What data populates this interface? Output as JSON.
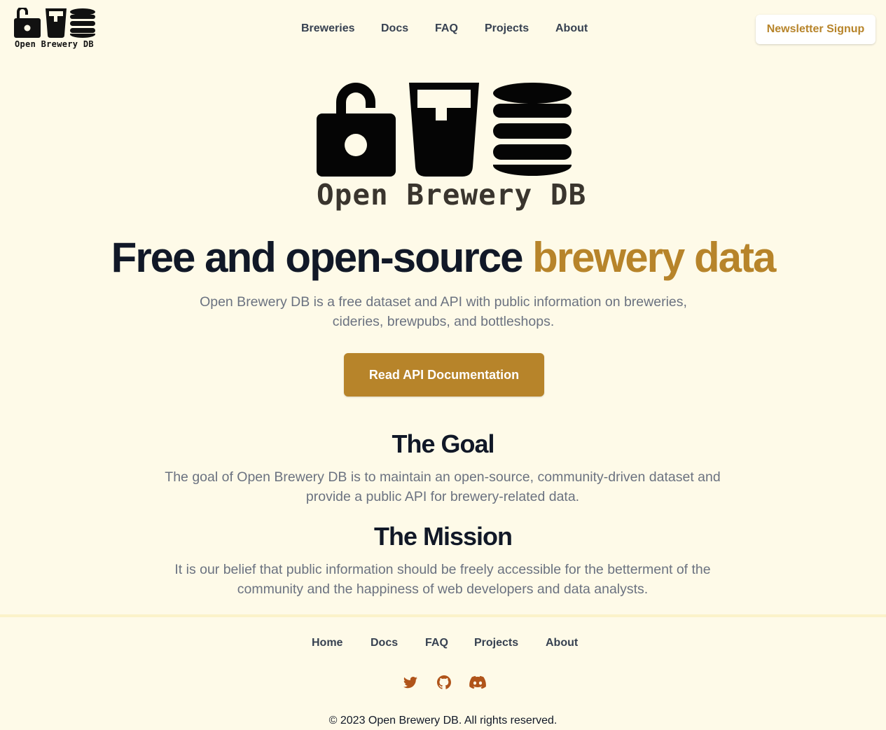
{
  "header": {
    "logo_text": "Open Brewery DB",
    "nav": [
      {
        "label": "Breweries"
      },
      {
        "label": "Docs"
      },
      {
        "label": "FAQ"
      },
      {
        "label": "Projects"
      },
      {
        "label": "About"
      }
    ],
    "signup_label": "Newsletter Signup"
  },
  "hero": {
    "logo_text": "Open Brewery DB",
    "headline_main": "Free and open-source ",
    "headline_accent": "brewery data",
    "subtitle": "Open Brewery DB is a free dataset and API with public information on breweries, cideries, brewpubs, and bottleshops.",
    "cta_label": "Read API Documentation"
  },
  "goal": {
    "title": "The Goal",
    "text": "The goal of Open Brewery DB is to maintain an open-source, community-driven dataset and provide a public API for brewery-related data."
  },
  "mission": {
    "title": "The Mission",
    "text": "It is our belief that public information should be freely accessible for the betterment of the community and the happiness of web developers and data analysts."
  },
  "footer": {
    "nav": [
      {
        "label": "Home"
      },
      {
        "label": "Docs"
      },
      {
        "label": "FAQ"
      },
      {
        "label": "Projects"
      },
      {
        "label": "About"
      }
    ],
    "social": [
      {
        "icon": "twitter-icon"
      },
      {
        "icon": "github-icon"
      },
      {
        "icon": "discord-icon"
      }
    ],
    "copyright": "© 2023 Open Brewery DB. All rights reserved."
  },
  "colors": {
    "background": "#fefae8",
    "accent": "#b7842a",
    "social_icon": "#b0541a",
    "heading": "#111827",
    "body_text": "#6b7280"
  }
}
